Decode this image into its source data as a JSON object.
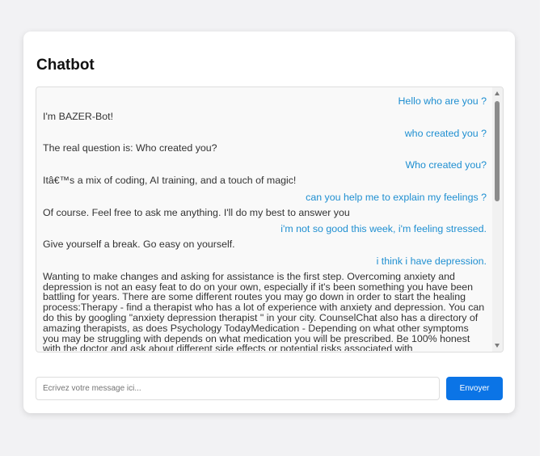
{
  "chatbot": {
    "title": "Chatbot",
    "messages": [
      {
        "from": "user",
        "text": "Hello who are you ?"
      },
      {
        "from": "bot",
        "text": "I'm BAZER-Bot!"
      },
      {
        "from": "user",
        "text": "who created you ?"
      },
      {
        "from": "bot",
        "text": "The real question is: Who created you?"
      },
      {
        "from": "user",
        "text": "Who created you?"
      },
      {
        "from": "bot",
        "text": "Itâ€™s a mix of coding, AI training, and a touch of magic!"
      },
      {
        "from": "user",
        "text": "can you help me to explain my feelings ?"
      },
      {
        "from": "bot",
        "text": "Of course. Feel free to ask me anything. I'll do my best to answer you"
      },
      {
        "from": "user",
        "text": "i'm not so good this week, i'm feeling stressed."
      },
      {
        "from": "bot",
        "text": "Give yourself a break. Go easy on yourself."
      },
      {
        "from": "user",
        "text": "i think i have depression."
      },
      {
        "from": "bot",
        "text": "Wanting to make changes and asking for assistance is the first step. Overcoming anxiety and depression is not an easy feat to do on your own, especially if it's been something you have been battling for years. There are some different routes you may go down in order to start the healing process:Therapy - find a therapist who has a lot of experience with anxiety and depression. You can do this by googling \"anxiety depression therapist \" in your city. CounselChat also has a directory of amazing therapists, as does Psychology TodayMedication - Depending on what other symptoms you may be struggling with depends on what medication you will be prescribed. Be 100% honest with the doctor and ask about different side effects or potential risks associated with"
      }
    ],
    "input": {
      "placeholder": "Écrivez votre message ici...",
      "value": ""
    },
    "send_label": "Envoyer"
  },
  "colors": {
    "user_text": "#1f8fd1",
    "bot_text": "#333333",
    "send_button": "#0b74e6"
  }
}
